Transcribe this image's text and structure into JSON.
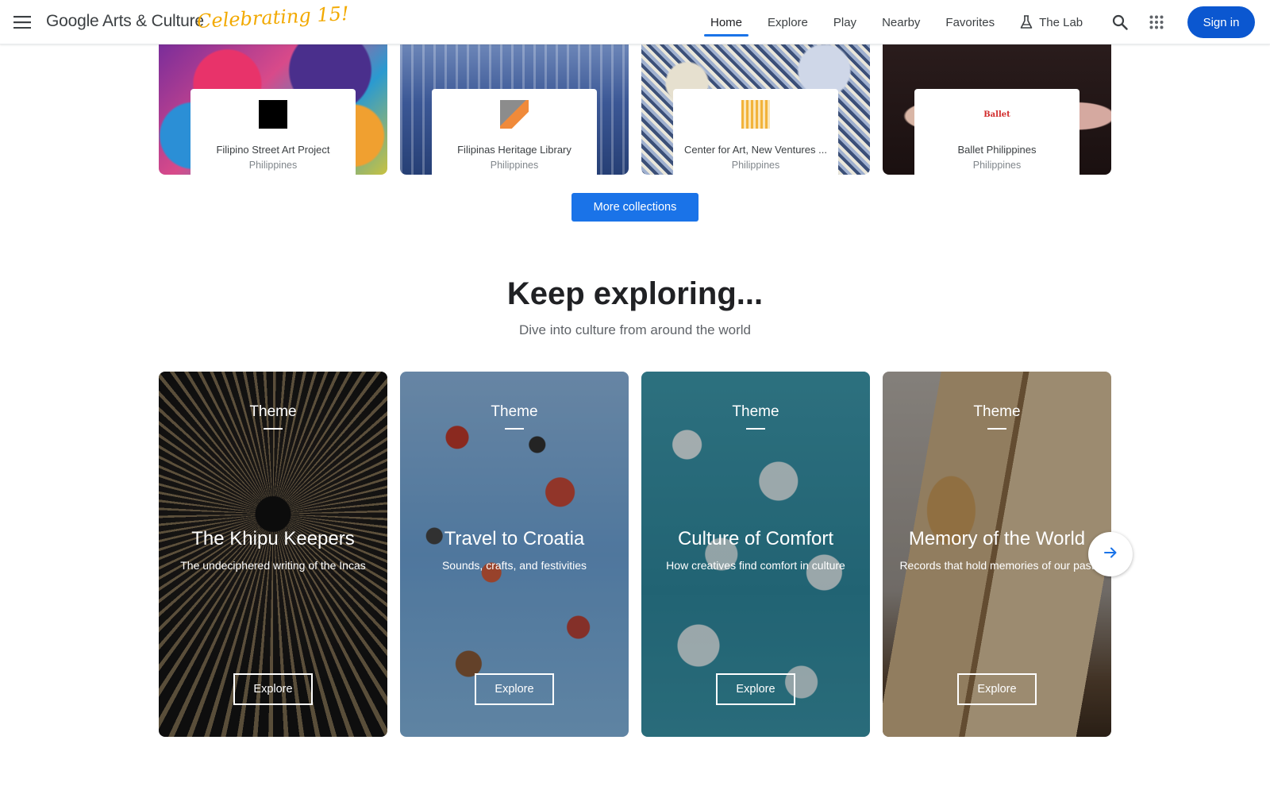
{
  "header": {
    "logo_text": "Google Arts & Culture",
    "celebration_text": "Celebrating 15!",
    "nav": [
      {
        "label": "Home",
        "active": true
      },
      {
        "label": "Explore",
        "active": false
      },
      {
        "label": "Play",
        "active": false
      },
      {
        "label": "Nearby",
        "active": false
      },
      {
        "label": "Favorites",
        "active": false
      },
      {
        "label": "The Lab",
        "active": false,
        "icon": "flask-icon"
      }
    ],
    "sign_in_label": "Sign in",
    "icons": [
      "menu-icon",
      "search-icon",
      "apps-grid-icon"
    ]
  },
  "collections": {
    "items": [
      {
        "name": "Filipino Street Art Project",
        "country": "Philippines"
      },
      {
        "name": "Filipinas Heritage Library",
        "country": "Philippines"
      },
      {
        "name": "Center for Art, New Ventures ...",
        "country": "Philippines"
      },
      {
        "name": "Ballet Philippines",
        "country": "Philippines",
        "logo_text": "Ballet"
      }
    ],
    "more_label": "More collections"
  },
  "keep_exploring": {
    "title": "Keep exploring...",
    "subtitle": "Dive into culture from around the world",
    "themes": [
      {
        "kicker": "Theme",
        "title": "The Khipu Keepers",
        "description": "The undeciphered writing of the Incas",
        "button": "Explore"
      },
      {
        "kicker": "Theme",
        "title": "Travel to Croatia",
        "description": "Sounds, crafts, and festivities",
        "button": "Explore"
      },
      {
        "kicker": "Theme",
        "title": "Culture of Comfort",
        "description": "How creatives find comfort in culture",
        "button": "Explore"
      },
      {
        "kicker": "Theme",
        "title": "Memory of the World",
        "description": "Records that hold memories of our past",
        "button": "Explore"
      }
    ],
    "next_icon": "arrow-right-icon"
  },
  "colors": {
    "accent": "#1a73e8",
    "sign_in": "#0b57d0",
    "celebrate": "#f2a900"
  }
}
